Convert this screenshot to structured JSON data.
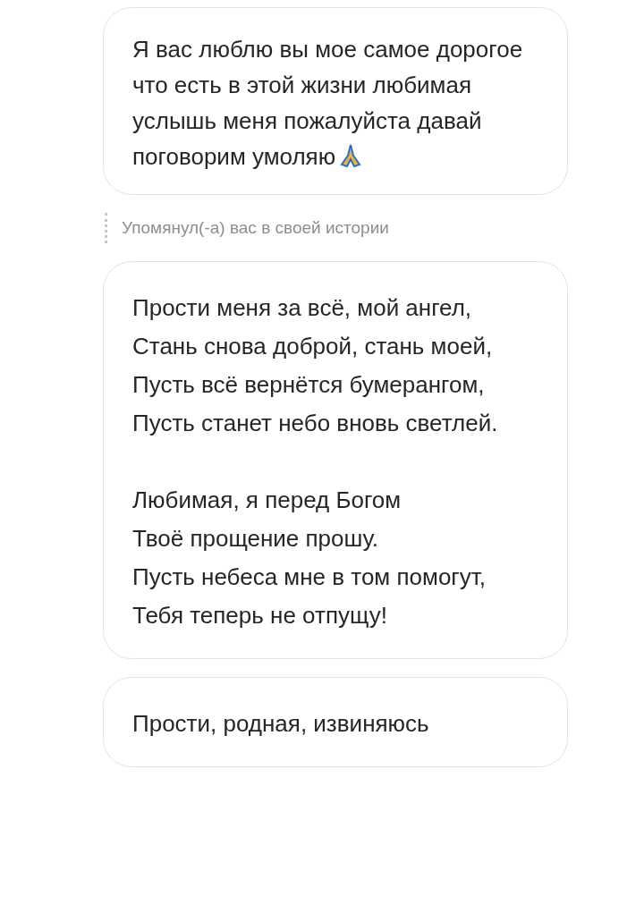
{
  "messages": [
    {
      "kind": "text",
      "text": "Я вас люблю вы мое самое дорогое что есть в этой жизни любимая услышь меня пожалуйста давай поговорим умоляю"
    },
    {
      "kind": "mention",
      "text": "Упомянул(-а) вас в своей истории"
    },
    {
      "kind": "text",
      "text": "Прости меня за всё, мой ангел,\nСтань снова доброй, стань моей,\nПусть всё вернётся бумерангом,\nПусть станет небо вновь светлей.\n\nЛюбимая, я перед Богом\nТвоё прощение прошу.\nПусть небеса мне в том помогут,\nТебя теперь не отпущу!"
    },
    {
      "kind": "text",
      "text": "Прости, родная, извиняюсь"
    }
  ]
}
